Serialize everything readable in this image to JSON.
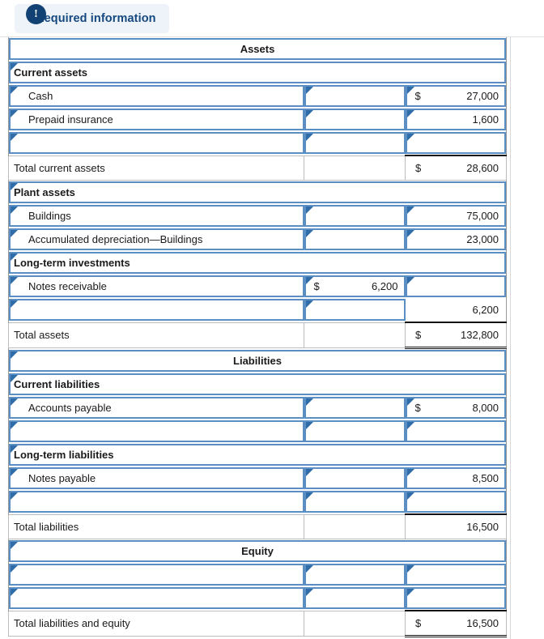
{
  "banner": {
    "badge_glyph": "!",
    "label": "Required information"
  },
  "worksheet": {
    "title_rows": {
      "assets": "Assets",
      "liabilities": "Liabilities",
      "equity": "Equity"
    },
    "currency_symbol": "$",
    "rows": [
      {
        "kind": "title",
        "label": "Assets"
      },
      {
        "kind": "section",
        "label": "Current assets"
      },
      {
        "kind": "item",
        "label": "Cash",
        "mid_sym": "",
        "mid_val": "",
        "right_sym": "$",
        "right_val": "27,000"
      },
      {
        "kind": "item",
        "label": "Prepaid insurance",
        "mid_sym": "",
        "mid_val": "",
        "right_sym": "",
        "right_val": "1,600"
      },
      {
        "kind": "item",
        "label": "",
        "mid_sym": "",
        "mid_val": "",
        "right_sym": "",
        "right_val": ""
      },
      {
        "kind": "total",
        "label": "Total current assets",
        "mid_sym": "",
        "mid_val": "",
        "right_sym": "$",
        "right_val": "28,600"
      },
      {
        "kind": "section",
        "label": "Plant assets"
      },
      {
        "kind": "item",
        "label": "Buildings",
        "mid_sym": "",
        "mid_val": "",
        "right_sym": "",
        "right_val": "75,000"
      },
      {
        "kind": "item",
        "label": "Accumulated depreciation—Buildings",
        "mid_sym": "",
        "mid_val": "",
        "right_sym": "",
        "right_val": "23,000"
      },
      {
        "kind": "section",
        "label": "Long-term investments"
      },
      {
        "kind": "item",
        "label": "Notes receivable",
        "mid_sym": "$",
        "mid_val": "6,200",
        "right_sym": "",
        "right_val": ""
      },
      {
        "kind": "itemr",
        "label": "",
        "mid_sym": "",
        "mid_val": "",
        "right_sym": "",
        "right_val": "6,200"
      },
      {
        "kind": "total",
        "label": "Total assets",
        "mid_sym": "",
        "mid_val": "",
        "right_sym": "$",
        "right_val": "132,800"
      },
      {
        "kind": "title",
        "label": "Liabilities"
      },
      {
        "kind": "section",
        "label": "Current liabilities"
      },
      {
        "kind": "item",
        "label": "Accounts payable",
        "mid_sym": "",
        "mid_val": "",
        "right_sym": "$",
        "right_val": "8,000"
      },
      {
        "kind": "item",
        "label": "",
        "mid_sym": "",
        "mid_val": "",
        "right_sym": "",
        "right_val": ""
      },
      {
        "kind": "section",
        "label": "Long-term liabilities"
      },
      {
        "kind": "item",
        "label": "Notes payable",
        "mid_sym": "",
        "mid_val": "",
        "right_sym": "",
        "right_val": "8,500"
      },
      {
        "kind": "item",
        "label": "",
        "mid_sym": "",
        "mid_val": "",
        "right_sym": "",
        "right_val": ""
      },
      {
        "kind": "total",
        "label": "Total liabilities",
        "mid_sym": "",
        "mid_val": "",
        "right_sym": "",
        "right_val": "16,500"
      },
      {
        "kind": "title",
        "label": "Equity"
      },
      {
        "kind": "item",
        "label": "",
        "mid_sym": "",
        "mid_val": "",
        "right_sym": "",
        "right_val": ""
      },
      {
        "kind": "item",
        "label": "",
        "mid_sym": "",
        "mid_val": "",
        "right_sym": "",
        "right_val": ""
      },
      {
        "kind": "total",
        "label": "Total liabilities and equity",
        "mid_sym": "$",
        "mid_val": "",
        "right_sym": "$",
        "right_val": "16,500"
      }
    ]
  }
}
